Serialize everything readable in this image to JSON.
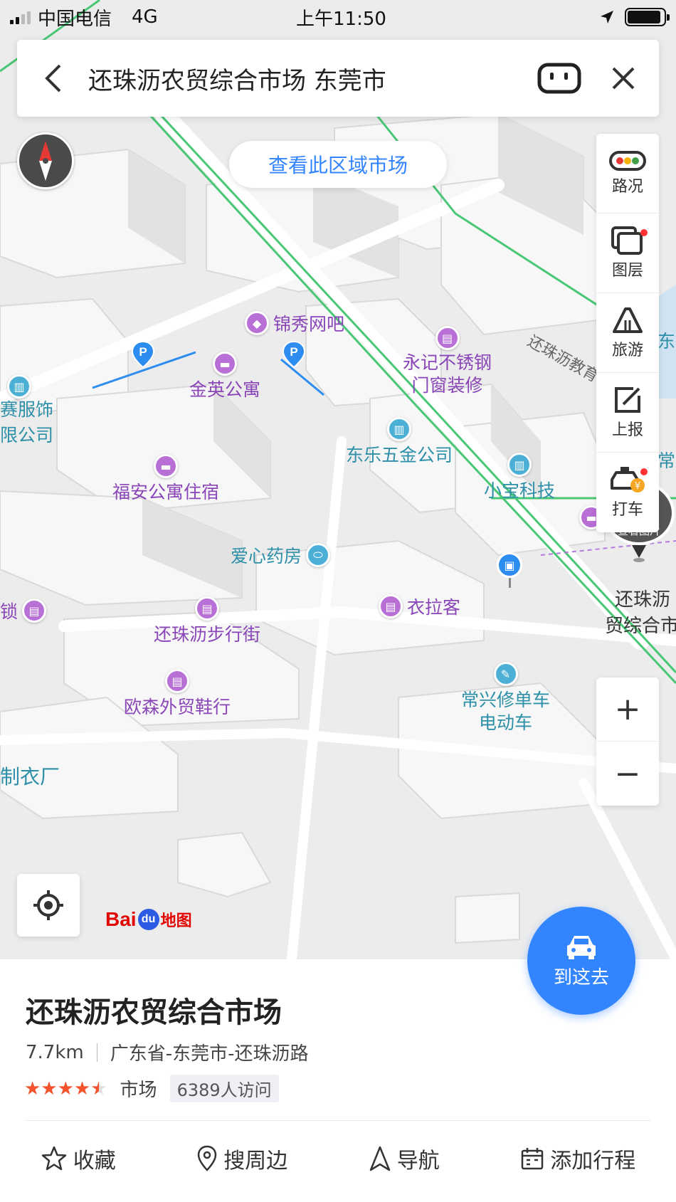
{
  "status_bar": {
    "carrier": "中国电信",
    "network": "4G",
    "time": "上午11:50"
  },
  "search": {
    "query": "还珠沥农贸综合市场 东莞市"
  },
  "map": {
    "region_button": "查看此区域市场",
    "toolbar": [
      {
        "label": "路况",
        "icon": "traffic-light-icon"
      },
      {
        "label": "图层",
        "icon": "layers-icon"
      },
      {
        "label": "旅游",
        "icon": "travel-icon"
      },
      {
        "label": "上报",
        "icon": "report-icon"
      },
      {
        "label": "打车",
        "icon": "taxi-icon"
      }
    ],
    "zoom_in": "+",
    "zoom_out": "−",
    "pois": {
      "jinxiu": "锦秀网吧",
      "yongji": "永记不锈钢\n门窗装修",
      "jinying": "金英公寓",
      "saifu_1": "赛服饰",
      "saifu_2": "限公司",
      "dongle": "东乐五金公司",
      "xiaobao": "小宝科技",
      "fuan": "福安公寓住宿",
      "aixin": "爱心药房",
      "yilake": "衣拉客",
      "buxingjie": "还珠沥步行街",
      "ousen": "欧森外贸鞋行",
      "changxing_1": "常兴修单车",
      "changxing_2": "电动车",
      "yichang": "制衣厂",
      "dest_1": "还珠沥",
      "dest_2": "贸综合市",
      "chang_edge": "常",
      "suo": "锁",
      "dong_edge": "东",
      "view_photo": "查看图片"
    },
    "road_label": "还珠沥教育"
  },
  "logo": {
    "bai": "Bai",
    "du": "du",
    "ditu": "地图"
  },
  "goto_button": "到这去",
  "place": {
    "name": "还珠沥农贸综合市场",
    "distance": "7.7km",
    "address": "广东省-东莞市-还珠沥路",
    "rating": 4.5,
    "stars": "★★★★★",
    "category": "市场",
    "visits": "6389人访问"
  },
  "actions": [
    {
      "label": "收藏",
      "icon": "star-icon"
    },
    {
      "label": "搜周边",
      "icon": "location-pin-icon"
    },
    {
      "label": "导航",
      "icon": "navigation-icon"
    },
    {
      "label": "添加行程",
      "icon": "calendar-icon"
    }
  ],
  "colors": {
    "accent": "#3385ff",
    "poi": "#8a46b8",
    "route_green": "#48c774",
    "star": "#f4532d"
  }
}
